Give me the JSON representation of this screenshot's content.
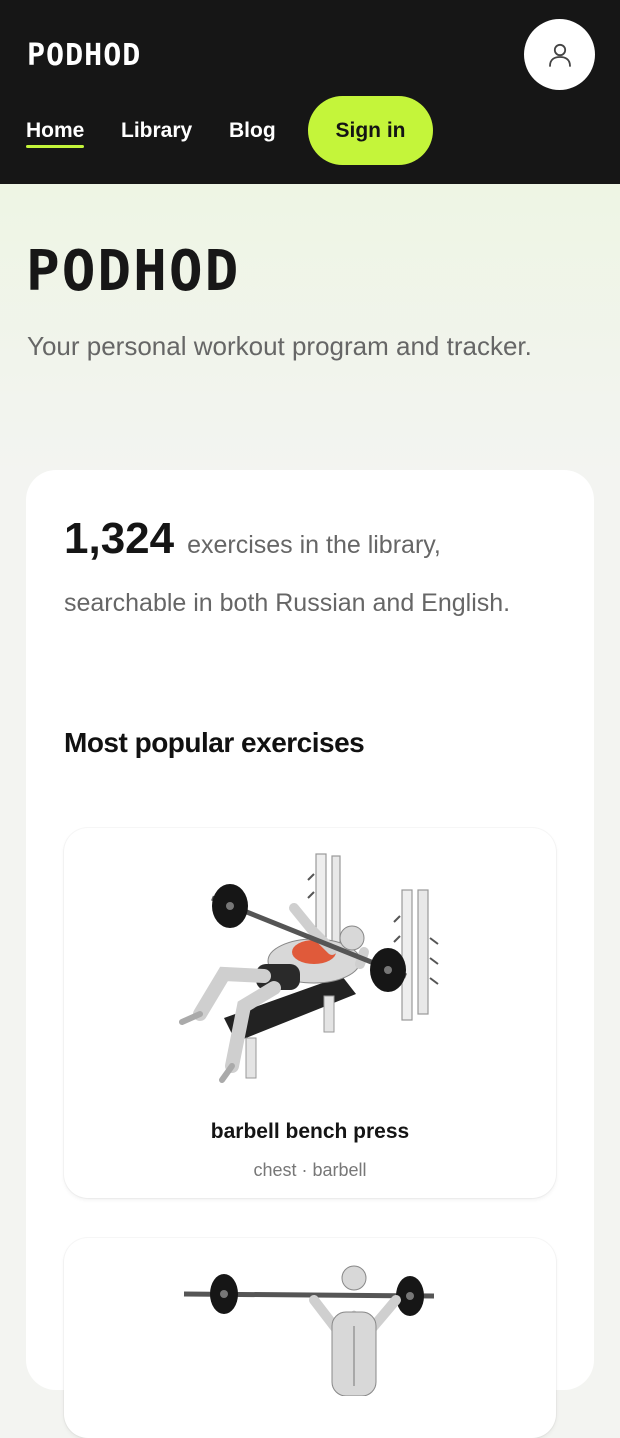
{
  "header": {
    "logo": "PODHOD",
    "nav": [
      {
        "label": "Home",
        "active": true
      },
      {
        "label": "Library",
        "active": false
      },
      {
        "label": "Blog",
        "active": false
      }
    ],
    "signin_label": "Sign in",
    "account_icon": "user-icon",
    "accent_color": "#c4f53a"
  },
  "hero": {
    "title": "PODHOD",
    "subtitle": "Your personal workout program and tracker."
  },
  "stats": {
    "count": "1,324",
    "text": "exercises in the library, searchable in both Russian and English."
  },
  "popular": {
    "title": "Most popular exercises",
    "items": [
      {
        "name": "barbell bench press",
        "meta": "chest · barbell",
        "image": "bench-press-illustration"
      },
      {
        "name": "",
        "meta": "",
        "image": "overhead-press-illustration"
      }
    ]
  }
}
